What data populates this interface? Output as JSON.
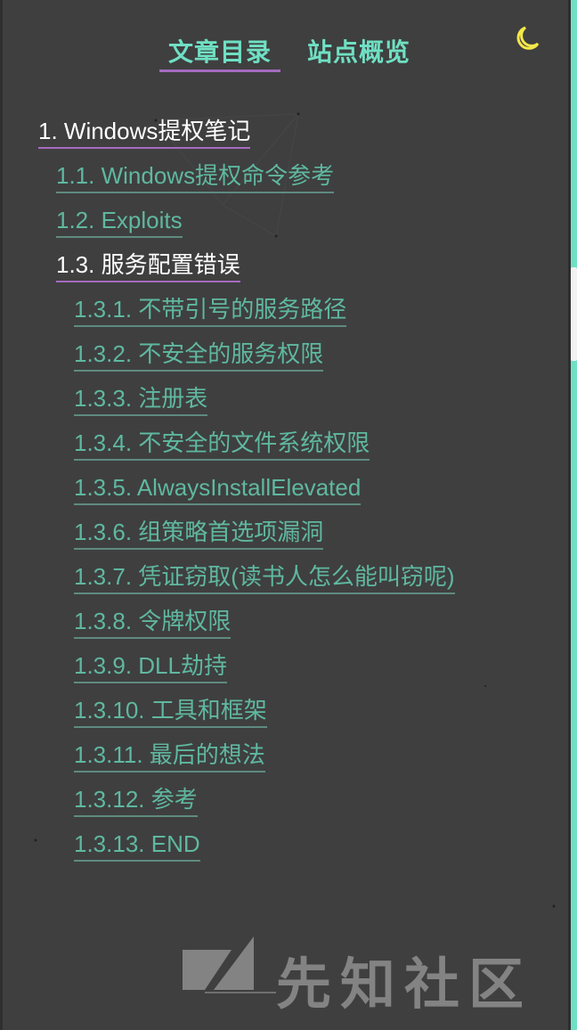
{
  "tabs": {
    "toc_label": "文章目录",
    "overview_label": "站点概览"
  },
  "toc": [
    {
      "label": "1. Windows提权笔记",
      "level": 1,
      "active": true
    },
    {
      "label": "1.1. Windows提权命令参考",
      "level": 2
    },
    {
      "label": "1.2. Exploits",
      "level": 2
    },
    {
      "label": "1.3. 服务配置错误",
      "level": 2,
      "active": true
    },
    {
      "label": "1.3.1. 不带引号的服务路径",
      "level": 3
    },
    {
      "label": "1.3.2. 不安全的服务权限",
      "level": 3
    },
    {
      "label": "1.3.3. 注册表",
      "level": 3
    },
    {
      "label": "1.3.4. 不安全的文件系统权限",
      "level": 3
    },
    {
      "label": "1.3.5. AlwaysInstallElevated",
      "level": 3
    },
    {
      "label": "1.3.6. 组策略首选项漏洞",
      "level": 3
    },
    {
      "label": "1.3.7. 凭证窃取(读书人怎么能叫窃呢)",
      "level": 3
    },
    {
      "label": "1.3.8. 令牌权限",
      "level": 3
    },
    {
      "label": "1.3.9. DLL劫持",
      "level": 3
    },
    {
      "label": "1.3.10. 工具和框架",
      "level": 3
    },
    {
      "label": "1.3.11. 最后的想法",
      "level": 3
    },
    {
      "label": "1.3.12. 参考",
      "level": 3
    },
    {
      "label": "1.3.13. END",
      "level": 3
    }
  ],
  "watermark": {
    "text": "先知社区"
  },
  "icons": {
    "theme_toggle": "moon-icon"
  },
  "colors": {
    "accent": "#6fe0c4",
    "link": "#5fb8a0",
    "underline_active": "#a56bbf",
    "background": "#3f3f3f"
  }
}
